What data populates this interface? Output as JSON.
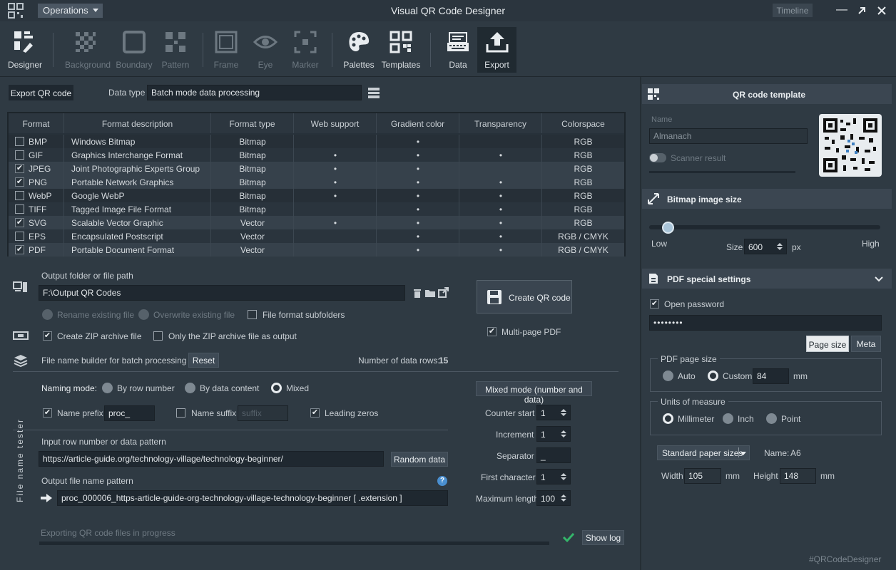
{
  "app": {
    "title": "Visual QR Code Designer",
    "menu": "Operations",
    "timeline": "Timeline",
    "hashtag": "#QRCodeDesigner"
  },
  "toolbar": [
    {
      "label": "Designer",
      "icon": "designer-icon"
    },
    {
      "label": "Background",
      "icon": "background-icon"
    },
    {
      "label": "Boundary",
      "icon": "boundary-icon"
    },
    {
      "label": "Pattern",
      "icon": "pattern-icon"
    },
    {
      "label": "Frame",
      "icon": "frame-icon"
    },
    {
      "label": "Eye",
      "icon": "eye-icon"
    },
    {
      "label": "Marker",
      "icon": "marker-icon"
    },
    {
      "label": "Palettes",
      "icon": "palettes-icon"
    },
    {
      "label": "Templates",
      "icon": "templates-icon"
    },
    {
      "label": "Data",
      "icon": "data-icon"
    },
    {
      "label": "Export",
      "icon": "export-icon"
    }
  ],
  "export": {
    "tab_label": "Export QR code",
    "data_type_label": "Data type",
    "data_type_value": "Batch mode data processing"
  },
  "table": {
    "headers": [
      "Format",
      "Format description",
      "Format type",
      "Web support",
      "Gradient color",
      "Transparency",
      "Colorspace"
    ],
    "bullet": "•",
    "rows": [
      {
        "checked": false,
        "format": "BMP",
        "desc": "Windows Bitmap",
        "type": "Bitmap",
        "web": false,
        "grad": true,
        "trans": false,
        "cs": "RGB"
      },
      {
        "checked": false,
        "format": "GIF",
        "desc": "Graphics Interchange Format",
        "type": "Bitmap",
        "web": true,
        "grad": true,
        "trans": true,
        "cs": "RGB"
      },
      {
        "checked": true,
        "format": "JPEG",
        "desc": "Joint Photographic Experts Group",
        "type": "Bitmap",
        "web": true,
        "grad": true,
        "trans": false,
        "cs": "RGB"
      },
      {
        "checked": true,
        "format": "PNG",
        "desc": "Portable Network Graphics",
        "type": "Bitmap",
        "web": true,
        "grad": true,
        "trans": true,
        "cs": "RGB"
      },
      {
        "checked": false,
        "format": "WebP",
        "desc": "Google WebP",
        "type": "Bitmap",
        "web": true,
        "grad": true,
        "trans": true,
        "cs": "RGB"
      },
      {
        "checked": false,
        "format": "TIFF",
        "desc": "Tagged Image File Format",
        "type": "Bitmap",
        "web": false,
        "grad": true,
        "trans": true,
        "cs": "RGB"
      },
      {
        "checked": true,
        "format": "SVG",
        "desc": "Scalable Vector Graphic",
        "type": "Vector",
        "web": true,
        "grad": true,
        "trans": true,
        "cs": "RGB"
      },
      {
        "checked": false,
        "format": "EPS",
        "desc": "Encapsulated Postscript",
        "type": "Vector",
        "web": false,
        "grad": true,
        "trans": true,
        "cs": "RGB / CMYK"
      },
      {
        "checked": true,
        "format": "PDF",
        "desc": "Portable Document Format",
        "type": "Vector",
        "web": false,
        "grad": true,
        "trans": true,
        "cs": "RGB / CMYK"
      }
    ]
  },
  "output": {
    "folder_label": "Output folder or file path",
    "folder_value": "F:\\Output QR Codes",
    "rename": "Rename existing file",
    "overwrite": "Overwrite existing file",
    "subfolders": "File format subfolders",
    "zip": "Create ZIP archive file",
    "zip_only": "Only the ZIP archive file as output",
    "create_btn": "Create QR code",
    "multipage": "Multi-page PDF"
  },
  "builder": {
    "title": "File name builder for batch processing",
    "reset": "Reset",
    "rows_label": "Number of data rows:",
    "rows_value": "15",
    "naming_label": "Naming mode:",
    "by_row": "By row number",
    "by_data": "By data content",
    "mixed": "Mixed",
    "prefix_label": "Name prefix",
    "prefix_value": "proc_",
    "suffix_label": "Name suffix",
    "suffix_placeholder": "suffix",
    "leading": "Leading zeros",
    "mixed_mode": "Mixed mode (number and data)",
    "counter_start": "Counter start",
    "counter_value": "1",
    "increment": "Increment",
    "increment_value": "1",
    "separator": "Separator",
    "separator_value": "_",
    "first_char": "First character",
    "first_char_value": "1",
    "max_len": "Maximum length",
    "max_len_value": "100",
    "tester_label": "File name tester",
    "input_label": "Input row number or data pattern",
    "input_value": "https://article-guide.org/technology-village/technology-beginner/",
    "random": "Random data",
    "pattern_label": "Output file name pattern",
    "pattern_value": "proc_000006_https-article-guide-org-technology-village-technology-beginner  [ .extension ]",
    "help": "?"
  },
  "progress": {
    "label": "Exporting QR code files in progress",
    "show_log": "Show log"
  },
  "template": {
    "title": "QR code template",
    "name_label": "Name",
    "name_value": "Almanach",
    "scanner": "Scanner result"
  },
  "bitmap": {
    "title": "Bitmap image size",
    "low": "Low",
    "high": "High",
    "size_label": "Size",
    "size_value": "600",
    "unit": "px",
    "level": 0.08
  },
  "pdf": {
    "title": "PDF special settings",
    "open_password": "Open password",
    "password": "••••••••",
    "page_size_btn": "Page size",
    "meta_btn": "Meta",
    "page_size_group": "PDF page size",
    "auto": "Auto",
    "custom": "Custom",
    "custom_value": "84",
    "custom_unit": "mm",
    "units_group": "Units of measure",
    "mm": "Millimeter",
    "inch": "Inch",
    "point": "Point",
    "paper_select": "Standard paper sizes",
    "name_label": "Name:",
    "name_value": "A6",
    "width_label": "Width",
    "width_value": "105",
    "height_label": "Height",
    "height_value": "148",
    "unit": "mm"
  }
}
